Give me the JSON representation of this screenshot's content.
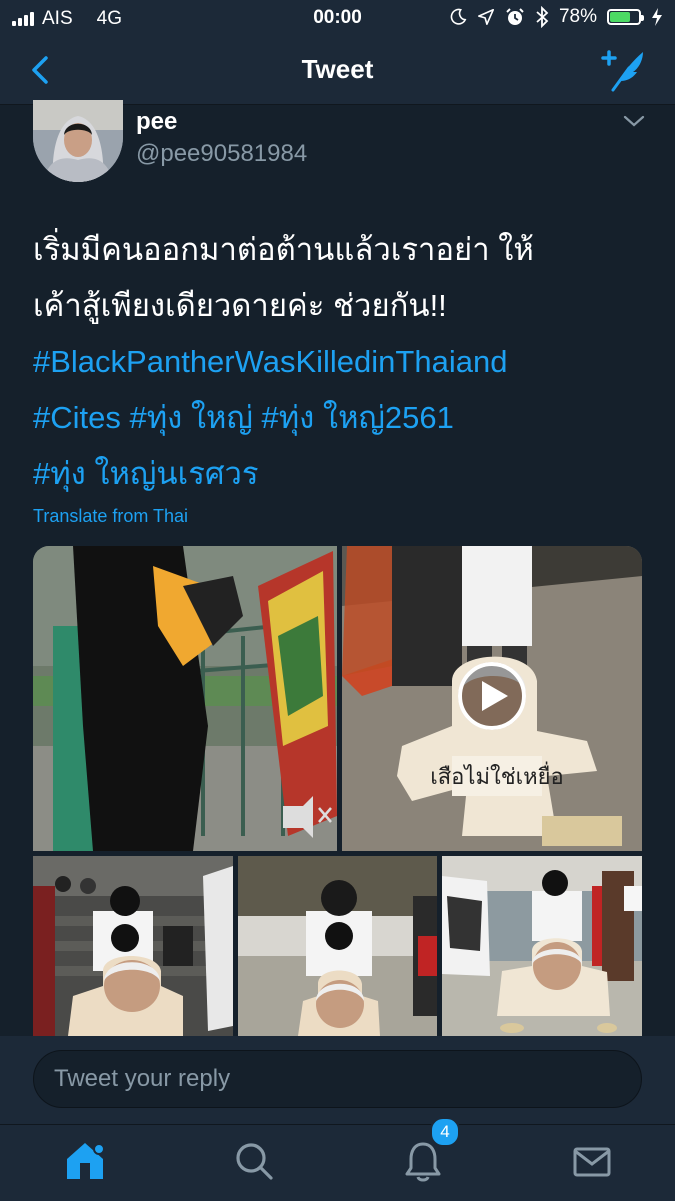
{
  "status_bar": {
    "carrier": "AIS",
    "network": "4G",
    "time": "00:00",
    "battery_percent": "78%",
    "battery_level": 0.78,
    "icons": [
      "moon-icon",
      "location-icon",
      "alarm-icon",
      "bluetooth-icon",
      "charging-icon"
    ]
  },
  "nav": {
    "title": "Tweet",
    "back_icon": "chevron-left-icon",
    "compose_icon": "compose-tweet-icon"
  },
  "tweet": {
    "author_name": "pee",
    "author_handle": "@pee90581984",
    "lines": [
      {
        "text": "เริ่มมีคนออกมาต่อต้านแล้วเราอย่า ให้",
        "hashtag": false
      },
      {
        "text": "เค้าสู้เพียงเดียวดายค่ะ ช่วยกัน!!",
        "hashtag": false
      },
      {
        "text": "#BlackPantherWasKilledinThaiand",
        "hashtag": true
      },
      {
        "text": "#Cites #ทุ่ง ใหญ่ #ทุ่ง ใหญ่2561",
        "hashtag": true
      },
      {
        "text": "#ทุ่ง ใหญ่นเรศวร",
        "hashtag": true
      }
    ],
    "translate_label": "Translate from Thai",
    "media_sign_text": "เสือไม่ใช่เหยื่อ"
  },
  "reply": {
    "placeholder": "Tweet your reply"
  },
  "tabbar": {
    "items": [
      "home-icon",
      "search-icon",
      "notifications-icon",
      "messages-icon"
    ],
    "notification_badge": "4"
  },
  "colors": {
    "background": "#15202b",
    "bar": "#1c2938",
    "accent": "#1da1f2",
    "secondary_text": "#8899a6"
  }
}
